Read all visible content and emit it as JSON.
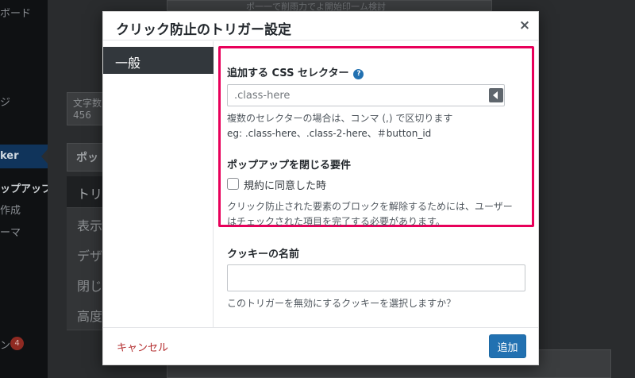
{
  "background": {
    "sidebar": {
      "item_dashboard_fragment": "ボード",
      "item_page_fragment": "ジ",
      "active_plugin_fragment": "ker",
      "submenu_popup": "ップアップ",
      "submenu_create": "作成",
      "submenu_theme": "ーマ",
      "item_plugins_fragment": "ン",
      "plugin_update_count": "4"
    },
    "header_fragment": "ポ一一で削雨力でよ開始印一ム検討",
    "word_count_label": "文字数",
    "word_count_value": "456",
    "panel_title_fragment": "ポッ",
    "tabs": [
      "トリ",
      "表示",
      "デザ",
      "閉じ",
      "高度"
    ]
  },
  "modal": {
    "title": "クリック防止のトリガー設定",
    "close_symbol": "×",
    "nav": {
      "general": "一般"
    },
    "fields": {
      "css_selector": {
        "label": "追加する CSS セレクター",
        "help_icon": "?",
        "placeholder": ".class-here",
        "value": "",
        "help_line1": "複数のセレクターの場合は、コンマ (,) で区切ります",
        "help_line2": "eg: .class-here、.class-2-here、＃button_id"
      },
      "close_requirement": {
        "label": "ポップアップを閉じる要件",
        "checkbox_label": "規約に同意した時",
        "checked": false,
        "help_line1": "クリック防止された要素のブロックを解除するためには、ユーザー",
        "help_line2": "はチェックされた項目を完了する必要があります。"
      },
      "cookie_name": {
        "label": "クッキーの名前",
        "value": "",
        "help": "このトリガーを無効にするクッキーを選択しますか？"
      }
    },
    "footer": {
      "cancel_label": "キャンセル",
      "add_label": "追加"
    }
  },
  "colors": {
    "highlight_border": "#e8005a",
    "primary_button": "#2271b1",
    "cancel_link": "#b32d2e",
    "nav_active_bg": "#32373c"
  },
  "icons": [
    "help-icon",
    "close-icon",
    "select-arrow-icon"
  ]
}
